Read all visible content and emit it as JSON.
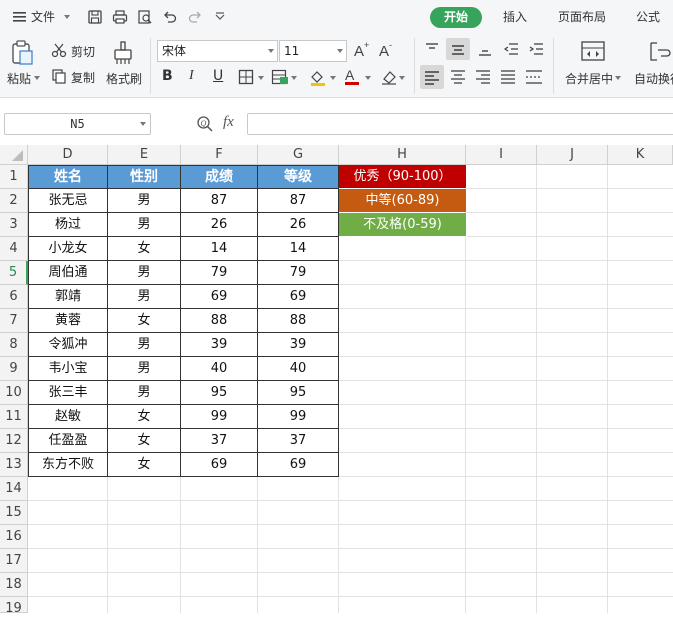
{
  "menu": {
    "file_label": "文件",
    "tabs": [
      "开始",
      "插入",
      "页面布局",
      "公式"
    ]
  },
  "ribbon": {
    "paste_label": "粘贴",
    "cut_label": "剪切",
    "copy_label": "复制",
    "format_painter_label": "格式刷",
    "font_name": "宋体",
    "font_size": "11",
    "bold_label": "B",
    "italic_label": "I",
    "underline_label": "U",
    "merge_center_label": "合并居中",
    "wrap_label": "自动换行"
  },
  "formula_bar": {
    "name_box": "N5",
    "fx_label": "fx",
    "formula": ""
  },
  "grid": {
    "columns": [
      "D",
      "E",
      "F",
      "G",
      "H",
      "I",
      "J",
      "K"
    ],
    "rows": [
      "1",
      "2",
      "3",
      "4",
      "5",
      "6",
      "7",
      "8",
      "9",
      "10",
      "11",
      "12",
      "13",
      "14",
      "15",
      "16",
      "17",
      "18",
      "19"
    ],
    "active_row": "5",
    "table_headers": [
      "姓名",
      "性别",
      "成绩",
      "等级"
    ],
    "table_rows": [
      [
        "张无忌",
        "男",
        "87",
        "87"
      ],
      [
        "杨过",
        "男",
        "26",
        "26"
      ],
      [
        "小龙女",
        "女",
        "14",
        "14"
      ],
      [
        "周伯通",
        "男",
        "79",
        "79"
      ],
      [
        "郭靖",
        "男",
        "69",
        "69"
      ],
      [
        "黄蓉",
        "女",
        "88",
        "88"
      ],
      [
        "令狐冲",
        "男",
        "39",
        "39"
      ],
      [
        "韦小宝",
        "男",
        "40",
        "40"
      ],
      [
        "张三丰",
        "男",
        "95",
        "95"
      ],
      [
        "赵敏",
        "女",
        "99",
        "99"
      ],
      [
        "任盈盈",
        "女",
        "37",
        "37"
      ],
      [
        "东方不败",
        "女",
        "69",
        "69"
      ]
    ],
    "legend": [
      {
        "label": "优秀（90-100）",
        "color": "#c00000"
      },
      {
        "label": "中等(60-89)",
        "color": "#c55a11"
      },
      {
        "label": "不及格(0-59)",
        "color": "#70ad47"
      }
    ]
  },
  "colors": {
    "accent": "#37a45c",
    "header_fill": "#5b9bd5"
  }
}
